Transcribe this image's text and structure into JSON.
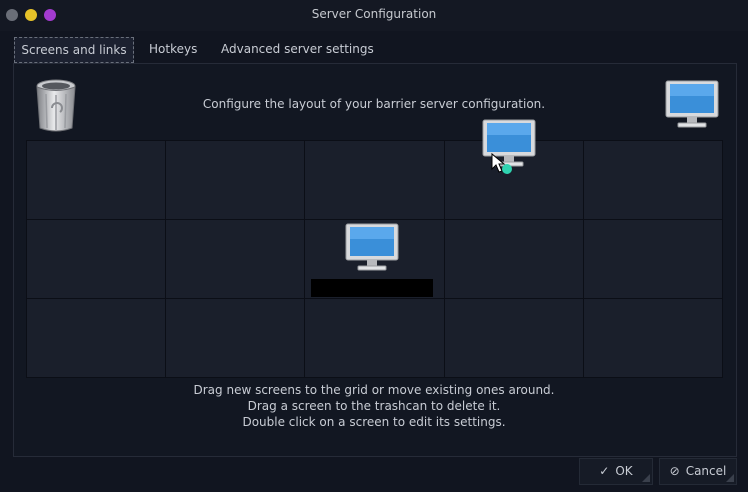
{
  "window": {
    "title": "Server Configuration"
  },
  "tabs": [
    {
      "label": "Screens and links",
      "active": true
    },
    {
      "label": "Hotkeys",
      "active": false
    },
    {
      "label": "Advanced server settings",
      "active": false
    }
  ],
  "screens": {
    "instructions_top": "Configure the layout of your barrier server configuration.",
    "instructions_bottom": [
      "Drag new screens to the grid or move existing ones around.",
      "Drag a screen to the trashcan to delete it.",
      "Double click on a screen to edit its settings."
    ],
    "grid": {
      "rows": 3,
      "columns": 5
    },
    "icons": {
      "trash": "trashcan-icon",
      "new_screen": "monitor-icon",
      "placed_screen": "monitor-icon",
      "dragged_screen": "monitor-icon",
      "cursor": "arrow-cursor-icon"
    }
  },
  "buttons": {
    "ok_label": "OK",
    "cancel_label": "Cancel",
    "ok_icon": "checkmark-icon",
    "cancel_icon": "cancel-circle-icon"
  },
  "colors": {
    "background": "#111520",
    "grid_cell": "#1a1f2b",
    "screen_blue": "#3a8fd9",
    "accent_cursor": "#2fd3b0"
  }
}
